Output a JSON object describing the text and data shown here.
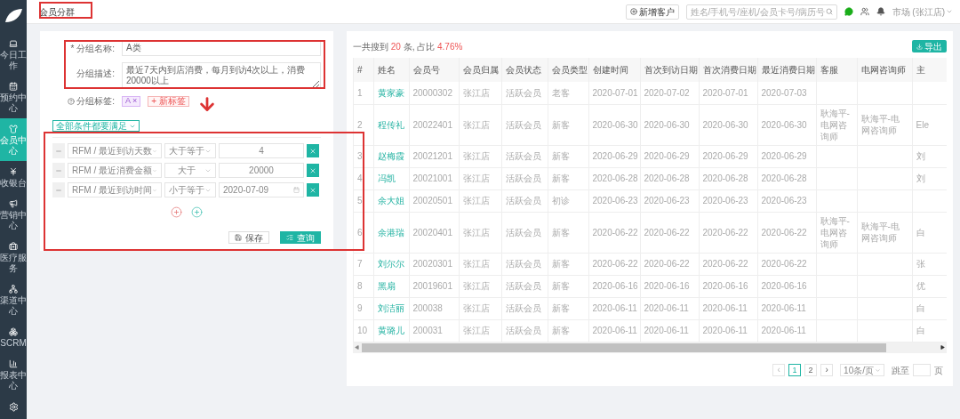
{
  "sidebar": {
    "items": [
      {
        "label": "今日工作",
        "selected": false
      },
      {
        "label": "预约中心",
        "selected": false
      },
      {
        "label": "会员中心",
        "selected": true
      },
      {
        "label": "收银台",
        "selected": false
      },
      {
        "label": "营销中心",
        "selected": false
      },
      {
        "label": "医疗服务",
        "selected": false
      },
      {
        "label": "渠道中心",
        "selected": false
      },
      {
        "label": "SCRM",
        "selected": false
      },
      {
        "label": "报表中心",
        "selected": false
      }
    ]
  },
  "header": {
    "tab": "会员分群",
    "new_button": "新增客户",
    "search_placeholder": "姓名/手机号/座机/会员卡号/病历号",
    "user": "市场 (张江店)"
  },
  "form": {
    "name_label": "* 分组名称:",
    "name_value": "A类",
    "desc_label": "分组描述:",
    "desc_value": "最近7天内到店消费，每月到访4次以上，消费20000以上",
    "tag_label": "分组标签:",
    "tags": [
      {
        "label": "A",
        "remove": "×"
      }
    ],
    "add_tag": "+ 新标签",
    "match_mode": "全部条件都要满足",
    "conditions": [
      {
        "field": "RFM / 最近到访天数",
        "operator": "大于等于",
        "value": "4",
        "kind": "number"
      },
      {
        "field": "RFM / 最近消费金额",
        "operator": "大于",
        "value": "20000",
        "kind": "number"
      },
      {
        "field": "RFM / 最近到访时间",
        "operator": "小于等于",
        "value": "2020-07-09",
        "kind": "date"
      }
    ],
    "save_button": "保存",
    "query_button": "查询"
  },
  "results": {
    "summary": {
      "prefix": "一共搜到",
      "count": "20",
      "middle": "条, 占比",
      "ratio": "4.76%"
    },
    "export_button": "导出",
    "columns": [
      "#",
      "姓名",
      "会员号",
      "会员归属",
      "会员状态",
      "会员类型",
      "创建时间",
      "首次到访日期",
      "首次消费日期",
      "最近消费日期",
      "客服",
      "电网咨询师",
      "主"
    ],
    "rows": [
      [
        "1",
        "黄家豪",
        "20000302",
        "张江店",
        "活跃会员",
        "老客",
        "2020-07-01",
        "2020-07-02",
        "2020-07-01",
        "2020-07-03",
        "",
        "",
        ""
      ],
      [
        "2",
        "程传礼",
        "20022401",
        "张江店",
        "活跃会员",
        "新客",
        "2020-06-30",
        "2020-06-30",
        "2020-06-30",
        "2020-06-30",
        "耿海平-电网咨询师",
        "耿海平-电网咨询师",
        "Ele"
      ],
      [
        "3",
        "赵梅霞",
        "20021201",
        "张江店",
        "活跃会员",
        "新客",
        "2020-06-29",
        "2020-06-29",
        "2020-06-29",
        "2020-06-29",
        "",
        "",
        "刘"
      ],
      [
        "4",
        "冯凯",
        "20021001",
        "张江店",
        "活跃会员",
        "新客",
        "2020-06-28",
        "2020-06-28",
        "2020-06-28",
        "2020-06-28",
        "",
        "",
        "刘"
      ],
      [
        "5",
        "余大姐",
        "20020501",
        "张江店",
        "活跃会员",
        "初诊",
        "2020-06-23",
        "2020-06-23",
        "2020-06-23",
        "2020-06-23",
        "",
        "",
        ""
      ],
      [
        "6",
        "余港瑞",
        "20020401",
        "张江店",
        "活跃会员",
        "新客",
        "2020-06-22",
        "2020-06-22",
        "2020-06-22",
        "2020-06-22",
        "耿海平-电网咨询师",
        "耿海平-电网咨询师",
        "白"
      ],
      [
        "7",
        "刘尔尔",
        "20020301",
        "张江店",
        "活跃会员",
        "新客",
        "2020-06-22",
        "2020-06-22",
        "2020-06-22",
        "2020-06-22",
        "",
        "",
        "张"
      ],
      [
        "8",
        "黑扇",
        "20019601",
        "张江店",
        "活跃会员",
        "新客",
        "2020-06-16",
        "2020-06-16",
        "2020-06-16",
        "2020-06-16",
        "",
        "",
        "优"
      ],
      [
        "9",
        "刘洁丽",
        "200038",
        "张江店",
        "活跃会员",
        "新客",
        "2020-06-11",
        "2020-06-11",
        "2020-06-11",
        "2020-06-11",
        "",
        "",
        "白"
      ],
      [
        "10",
        "黄璐儿",
        "200031",
        "张江店",
        "活跃会员",
        "新客",
        "2020-06-11",
        "2020-06-11",
        "2020-06-11",
        "2020-06-11",
        "",
        "",
        "白"
      ]
    ],
    "pagination": {
      "prev": "‹",
      "next": "›",
      "pages": [
        {
          "label": "1",
          "selected": true
        },
        {
          "label": "2",
          "selected": false
        }
      ],
      "page_size": "10条/页",
      "jump_label": "跳至",
      "page_unit": "页"
    }
  }
}
